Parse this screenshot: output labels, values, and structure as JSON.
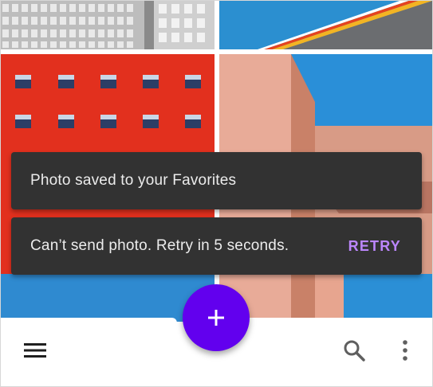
{
  "snackbars": [
    {
      "message": "Photo saved to your Favorites"
    },
    {
      "message": "Can’t send photo. Retry in 5 seconds.",
      "action": "RETRY"
    }
  ],
  "fab": {
    "icon": "add-icon"
  },
  "bottom_bar": {
    "left_icon": "menu-icon",
    "right_icons": [
      "search-icon",
      "more-vert-icon"
    ]
  },
  "colors": {
    "snackbar_bg": "#323232",
    "snackbar_action": "#bb86fc",
    "fab": "#6200ee",
    "bar": "#ffffff"
  }
}
